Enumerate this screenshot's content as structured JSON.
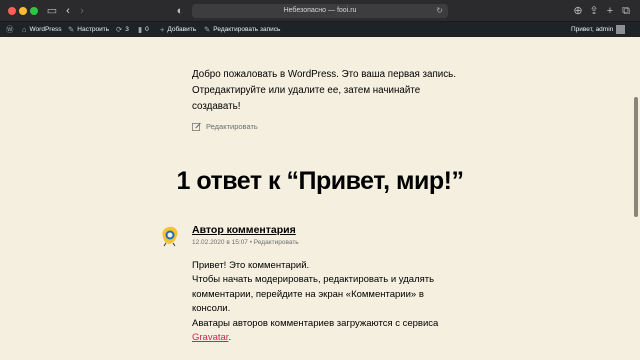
{
  "browser": {
    "address": "Небезопасно — fooi.ru"
  },
  "adminbar": {
    "wordpress": "WordPress",
    "customize": "Настроить",
    "updates": "3",
    "comments": "0",
    "new": "Добавить",
    "edit": "Редактировать запись",
    "greeting": "Привет, admin"
  },
  "post": {
    "intro": "Добро пожаловать в WordPress. Это ваша первая запись. Отредактируйте или удалите ее, затем начинайте создавать!",
    "edit_label": "Редактировать"
  },
  "comments": {
    "heading": "1 ответ к “Привет, мир!”",
    "items": [
      {
        "author": "Автор комментария",
        "date": "12.02.2020 в 15:07",
        "separator": "•",
        "edit": "Редактировать",
        "line1": "Привет! Это комментарий.",
        "line2": "Чтобы начать модерировать, редактировать и удалять комментарии, перейдите на экран «Комментарии» в консоли.",
        "line3": "Аватары авторов комментариев загружаются с сервиса",
        "link": "Gravatar",
        "end": "."
      }
    ]
  },
  "colors": {
    "page_bg": "#f5efe0",
    "adminbar_bg": "#1d2327",
    "accent": "#cd2653"
  }
}
